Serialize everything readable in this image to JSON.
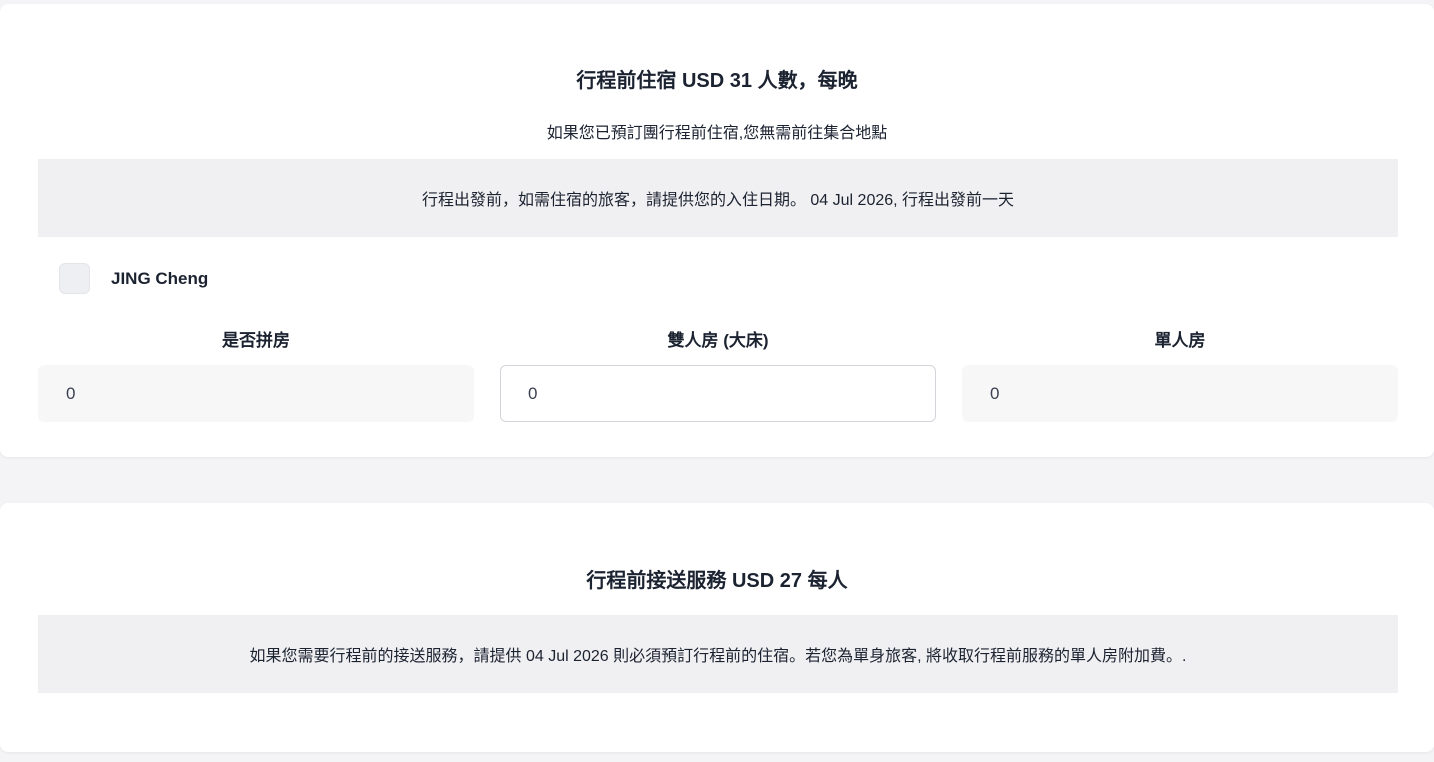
{
  "pre_tour_accommodation": {
    "title": "行程前住宿 USD 31 人數，每晚",
    "subtitle": "如果您已預訂團行程前住宿,您無需前往集合地點",
    "notice": "行程出發前，如需住宿的旅客，請提供您的入住日期。 04 Jul 2026, 行程出發前一天",
    "traveler": {
      "name": "JING Cheng",
      "checked": false
    },
    "rooms": [
      {
        "label": "是否拼房",
        "value": "0"
      },
      {
        "label": "雙人房 (大床)",
        "value": "0"
      },
      {
        "label": "單人房",
        "value": "0"
      }
    ]
  },
  "pre_tour_transfer": {
    "title": "行程前接送服務 USD 27 每人",
    "notice": "如果您需要行程前的接送服務，請提供 04 Jul 2026 則必須預訂行程前的住宿。若您為單身旅客, 將收取行程前服務的單人房附加費。."
  }
}
